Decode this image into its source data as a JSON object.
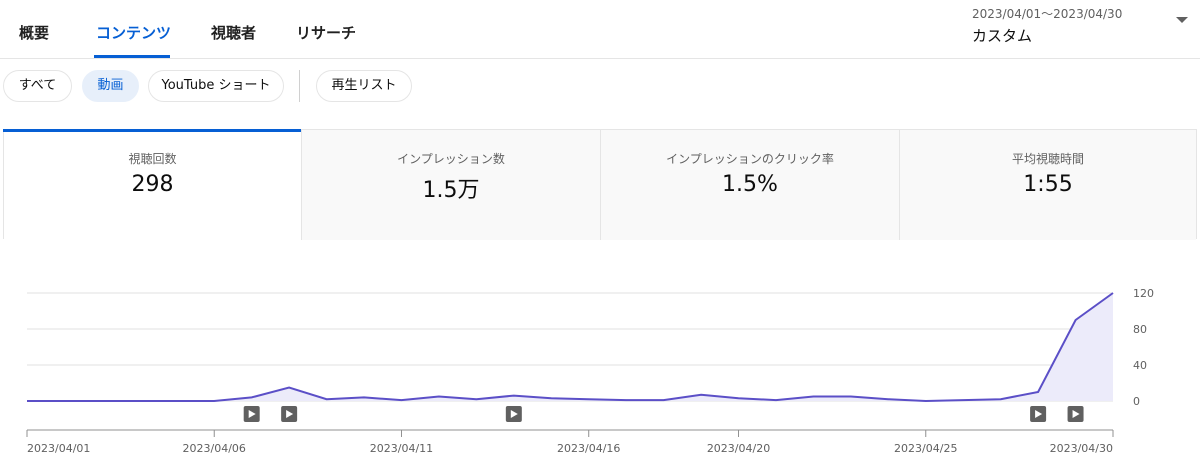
{
  "tabs": [
    {
      "label": "概要",
      "active": false
    },
    {
      "label": "コンテンツ",
      "active": true
    },
    {
      "label": "視聴者",
      "active": false
    },
    {
      "label": "リサーチ",
      "active": false
    }
  ],
  "date_range": {
    "range": "2023/04/01〜2023/04/30",
    "preset": "カスタム"
  },
  "chips": [
    {
      "label": "すべて",
      "selected": false
    },
    {
      "label": "動画",
      "selected": true
    },
    {
      "label": "YouTube ショート",
      "selected": false
    },
    {
      "label": "再生リスト",
      "selected": false
    }
  ],
  "metrics": [
    {
      "label": "視聴回数",
      "value": "298",
      "active": true
    },
    {
      "label": "インプレッション数",
      "value": "1.5万",
      "active": false
    },
    {
      "label": "インプレッションのクリック率",
      "value": "1.5%",
      "active": false
    },
    {
      "label": "平均視聴時間",
      "value": "1:55",
      "active": false
    }
  ],
  "colors": {
    "accent": "#065fd4",
    "line": "#5b4fc7",
    "area": "#ecebfa"
  },
  "chart_data": {
    "type": "area",
    "x": [
      "2023/04/01",
      "2023/04/02",
      "2023/04/03",
      "2023/04/04",
      "2023/04/05",
      "2023/04/06",
      "2023/04/07",
      "2023/04/08",
      "2023/04/09",
      "2023/04/10",
      "2023/04/11",
      "2023/04/12",
      "2023/04/13",
      "2023/04/14",
      "2023/04/15",
      "2023/04/16",
      "2023/04/17",
      "2023/04/18",
      "2023/04/19",
      "2023/04/20",
      "2023/04/21",
      "2023/04/22",
      "2023/04/23",
      "2023/04/24",
      "2023/04/25",
      "2023/04/26",
      "2023/04/27",
      "2023/04/28",
      "2023/04/29",
      "2023/04/30"
    ],
    "values": [
      0,
      0,
      0,
      0,
      0,
      0,
      4,
      15,
      2,
      4,
      1,
      5,
      2,
      6,
      3,
      2,
      1,
      1,
      7,
      3,
      1,
      5,
      5,
      2,
      0,
      1,
      2,
      10,
      90,
      120
    ],
    "x_tick_labels": [
      "2023/04/01",
      "2023/04/06",
      "2023/04/11",
      "2023/04/16",
      "2023/04/20",
      "2023/04/25",
      "2023/04/30"
    ],
    "x_tick_dates": [
      "2023/04/01",
      "2023/04/06",
      "2023/04/11",
      "2023/04/16",
      "2023/04/20",
      "2023/04/25",
      "2023/04/30"
    ],
    "y_ticks": [
      0,
      40,
      80,
      120
    ],
    "ylim": [
      0,
      120
    ],
    "video_markers": [
      "2023/04/07",
      "2023/04/08",
      "2023/04/14",
      "2023/04/28",
      "2023/04/29"
    ],
    "grid": true
  }
}
